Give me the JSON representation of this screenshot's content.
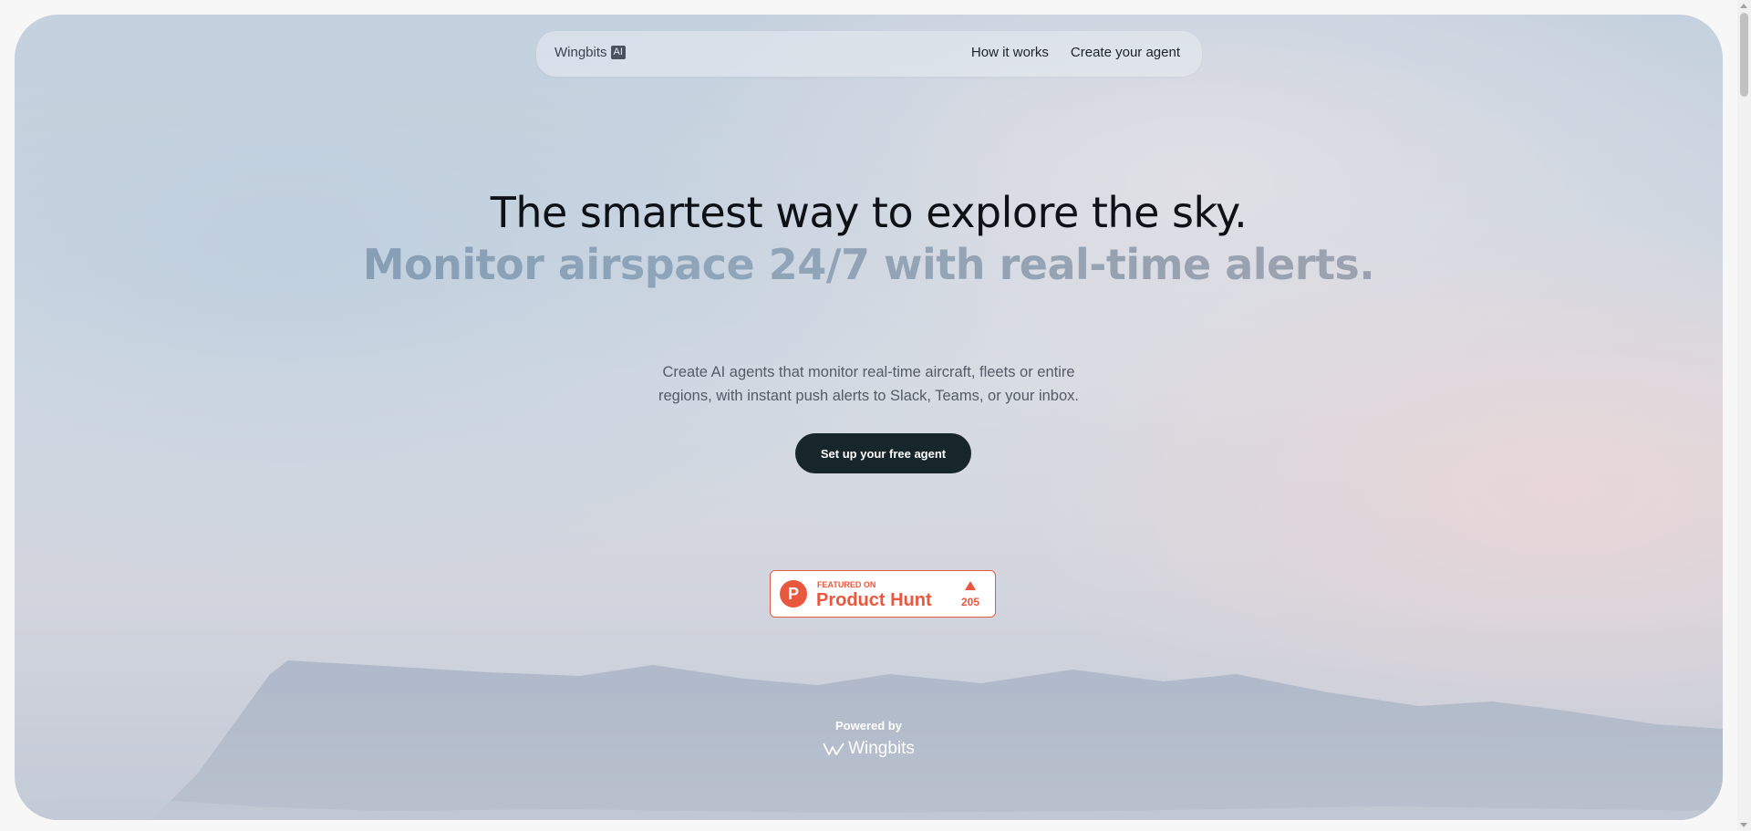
{
  "nav": {
    "logo_text": "Wingbits",
    "logo_badge": "AI",
    "links": [
      {
        "label": "How it works"
      },
      {
        "label": "Create your agent"
      }
    ]
  },
  "hero": {
    "headline": "The smartest way to explore the sky.",
    "subheadline": "Monitor airspace 24/7 with real-time alerts.",
    "description_line1": "Create AI agents that monitor real-time aircraft, fleets or entire",
    "description_line2": "regions, with instant push alerts to Slack, Teams, or your inbox.",
    "cta_label": "Set up your free agent"
  },
  "product_hunt": {
    "featured": "FEATURED ON",
    "name": "Product Hunt",
    "logo_letter": "P",
    "upvotes": "205",
    "brand_color": "#e9573f"
  },
  "footer": {
    "powered_by": "Powered by",
    "brand": "Wingbits"
  },
  "colors": {
    "cta_background": "#17262a",
    "headline": "#0e1216",
    "subheadline_gradient_start": "#7f98ae",
    "subheadline_gradient_end": "#a4a3ae"
  }
}
